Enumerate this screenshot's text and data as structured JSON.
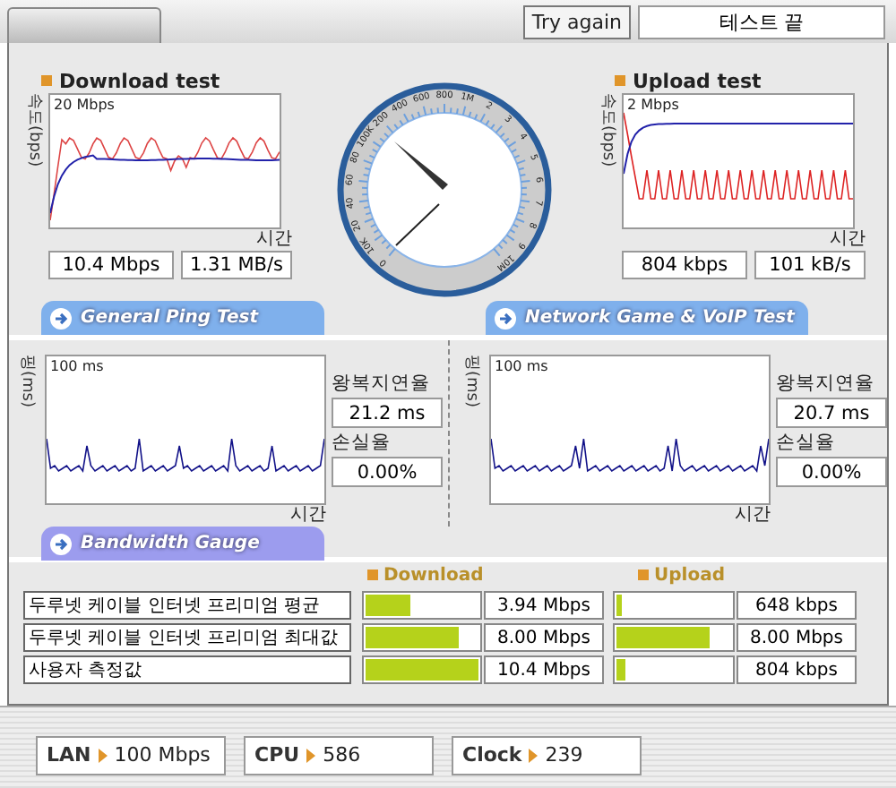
{
  "top": {
    "retry_button": "Try again",
    "status": "테스트 끝"
  },
  "speed_tests": [
    {
      "title": "Download test",
      "scale": "20 Mbps",
      "ylabel": "속도(bps)",
      "xlabel": "시간",
      "readings": [
        "10.4 Mbps",
        "1.31 MB/s"
      ]
    },
    {
      "title": "Upload test",
      "scale": "2 Mbps",
      "ylabel": "속도(bps)",
      "xlabel": "시간",
      "readings": [
        "804 kbps",
        "101 kB/s"
      ]
    }
  ],
  "gauge": {
    "labels": [
      "0",
      "10K",
      "20",
      "40",
      "60",
      "80",
      "100K",
      "200",
      "400",
      "600",
      "800",
      "1M",
      "2",
      "3",
      "4",
      "5",
      "6",
      "7",
      "8",
      "9",
      "10M"
    ]
  },
  "ping_tabs": [
    {
      "label": "General Ping Test"
    },
    {
      "label": "Network Game & VoIP Test"
    }
  ],
  "ping_panels": [
    {
      "scale": "100 ms",
      "ylabel": "핑(ms)",
      "xlabel": "시간",
      "rtt_label": "왕복지연율",
      "rtt": "21.2 ms",
      "loss_label": "손실율",
      "loss": "0.00%"
    },
    {
      "scale": "100 ms",
      "ylabel": "핑(ms)",
      "xlabel": "시간",
      "rtt_label": "왕복지연율",
      "rtt": "20.7 ms",
      "loss_label": "손실율",
      "loss": "0.00%"
    }
  ],
  "bandwidth": {
    "tab": "Bandwidth Gauge",
    "download_header": "Download",
    "upload_header": "Upload",
    "rows": [
      {
        "name": "두루넷 케이블 인터넷 프리미엄 평균",
        "download": {
          "level": 0.4,
          "reading": "3.94 Mbps"
        },
        "upload": {
          "level": 0.05,
          "reading": "648 kbps"
        }
      },
      {
        "name": "두루넷 케이블 인터넷 프리미엄 최대값",
        "download": {
          "level": 0.82,
          "reading": "8.00 Mbps"
        },
        "upload": {
          "level": 0.82,
          "reading": "8.00 Mbps"
        }
      },
      {
        "name": "사용자 측정값",
        "download": {
          "level": 1,
          "reading": "10.4 Mbps"
        },
        "upload": {
          "level": 0.08,
          "reading": "804 kbps"
        }
      }
    ]
  },
  "status_bar": [
    {
      "label": "LAN",
      "value": "100 Mbps"
    },
    {
      "label": "CPU",
      "value": "586"
    },
    {
      "label": "Clock",
      "value": "239"
    }
  ]
}
